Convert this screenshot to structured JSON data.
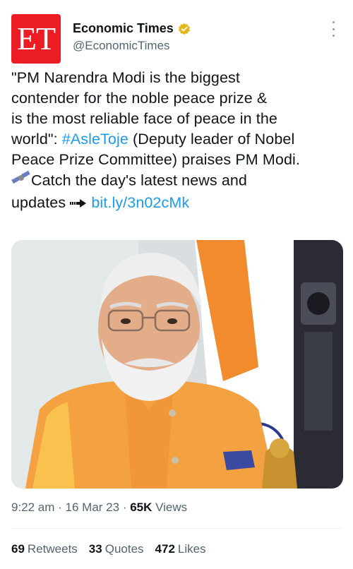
{
  "account": {
    "avatar_text": "ET",
    "display_name": "Economic Times",
    "handle": "@EconomicTimes",
    "verified_badge_color": "#e2b719",
    "avatar_color": "#ec1c24"
  },
  "tweet": {
    "line1": "\"PM Narendra Modi is the biggest",
    "line2": "contender for the noble peace prize &",
    "line3": "is the most reliable face of peace in the",
    "line4_pre": "world\": ",
    "hashtag": "#AsleToje",
    "line4_post": " (Deputy leader of Nobel",
    "line5": "Peace Prize Committee) praises PM Modi.",
    "line6": "Catch the day's latest news and",
    "line7_pre": "updates ",
    "link": "bit.ly/3n02cMk"
  },
  "meta": {
    "time": "9:22 am",
    "separator": " · ",
    "date": "16 Mar 23",
    "views_count": "65K",
    "views_label": " Views"
  },
  "stats": {
    "retweets_count": "69",
    "retweets_label": "Retweets",
    "quotes_count": "33",
    "quotes_label": "Quotes",
    "likes_count": "472",
    "likes_label": "Likes"
  },
  "icons": {
    "verified": "verified-badge-icon",
    "more": "more-options-icon",
    "satellite": "satellite-emoji-icon",
    "arrow": "right-arrow-icon"
  },
  "colors": {
    "link": "#1d9bf0",
    "secondary_text": "#536471"
  }
}
